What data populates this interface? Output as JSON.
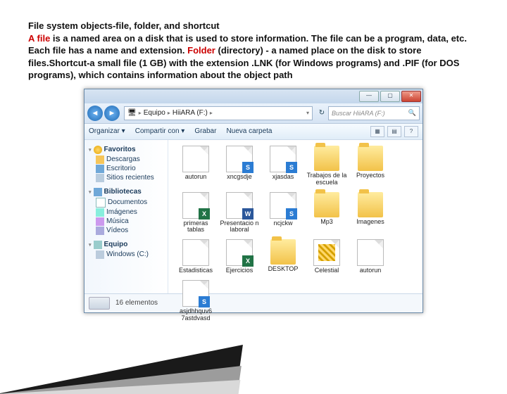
{
  "slide": {
    "line1": "File system objects-file, folder, and shortcut",
    "afile": "A file",
    "line2a": " is a named area on a disk that is used to store information. The file can be a program, data, etc. Each file has a name and extension. ",
    "folder": "Folder",
    "line2b": " (directory) - a named place on the disk to store files.Shortcut-a small file (1 GB) with the extension .LNK (for Windows programs) and .PIF (for DOS programs), which contains information about the object path"
  },
  "window": {
    "buttons": {
      "min": "—",
      "max": "▢",
      "close": "✕"
    },
    "nav": {
      "back": "◄",
      "fwd": "►"
    },
    "breadcrumb": {
      "pc_icon": "🖥",
      "seg1": "Equipo",
      "seg2": "HiiARA (F:)",
      "dropdown": "▾",
      "refresh": "↻"
    },
    "search": {
      "placeholder": "Buscar HiiARA (F:)",
      "icon": "🔍"
    },
    "toolbar": {
      "organize": "Organizar ▾",
      "share": "Compartir con ▾",
      "burn": "Grabar",
      "newfolder": "Nueva carpeta",
      "view1": "▦",
      "view2": "▤",
      "help": "?"
    },
    "sidebar": {
      "favorites": "Favoritos",
      "downloads": "Descargas",
      "desktop": "Escritorio",
      "recent": "Sitios recientes",
      "libraries": "Bibliotecas",
      "documents": "Documentos",
      "images": "Imágenes",
      "music": "Música",
      "videos": "Vídeos",
      "computer": "Equipo",
      "cdrive": "Windows (C:)"
    },
    "items": [
      {
        "name": "autorun",
        "type": "file",
        "badge": "",
        "bclass": ""
      },
      {
        "name": "xncgsdje",
        "type": "file",
        "badge": "S",
        "bclass": "bg-blue"
      },
      {
        "name": "xjasdas",
        "type": "file",
        "badge": "S",
        "bclass": "bg-blue"
      },
      {
        "name": "Trabajos de la escuela",
        "type": "folder"
      },
      {
        "name": "Proyectos",
        "type": "folder"
      },
      {
        "name": "primeras tablas",
        "type": "file",
        "badge": "X",
        "bclass": "bg-excel"
      },
      {
        "name": "Presentacio n laboral",
        "type": "file",
        "badge": "W",
        "bclass": "bg-word"
      },
      {
        "name": "ncjckw",
        "type": "file",
        "badge": "S",
        "bclass": "bg-blue"
      },
      {
        "name": "Mp3",
        "type": "folder"
      },
      {
        "name": "Imagenes",
        "type": "folder"
      },
      {
        "name": "Estadisticas",
        "type": "file",
        "badge": "",
        "bclass": ""
      },
      {
        "name": "Ejercicios",
        "type": "file",
        "badge": "X",
        "bclass": "bg-excel"
      },
      {
        "name": "DESKTOP",
        "type": "folder"
      },
      {
        "name": "Celestial",
        "type": "zip"
      },
      {
        "name": "autorun",
        "type": "file",
        "badge": "",
        "bclass": ""
      },
      {
        "name": "asjdhhquv6 7astdvasd",
        "type": "file",
        "badge": "S",
        "bclass": "bg-blue"
      }
    ],
    "status": {
      "count": "16 elementos"
    }
  }
}
